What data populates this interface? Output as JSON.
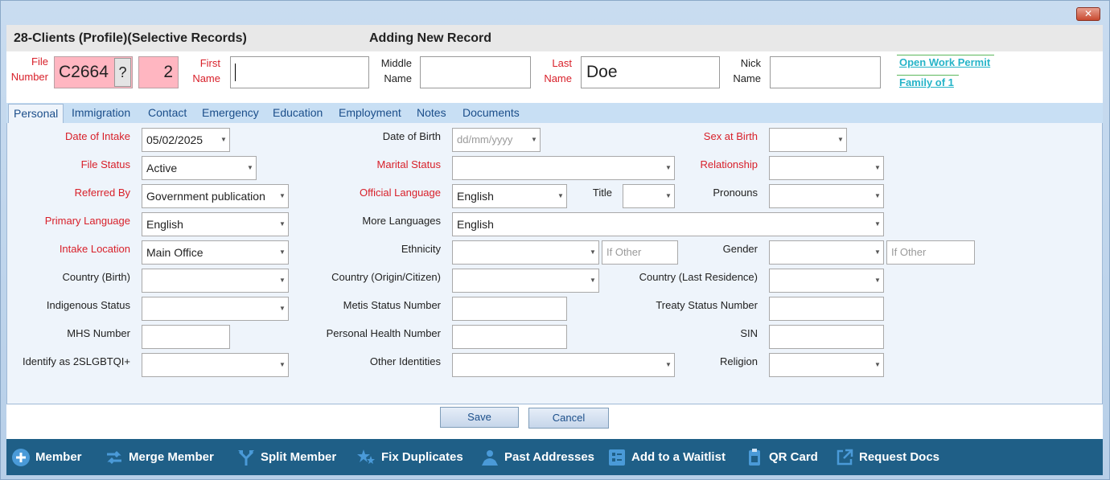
{
  "window": {
    "close_label": "✕"
  },
  "header": {
    "title": "28-Clients (Profile)(Selective Records)",
    "mode": "Adding New Record",
    "file_number_label_1": "File",
    "file_number_label_2": "Number",
    "file_number": "C2664",
    "lookup_label": "?",
    "sequence": "2",
    "first_name_label_1": "First",
    "first_name_label_2": "Name",
    "first_name_value": "",
    "middle_name_label_1": "Middle",
    "middle_name_label_2": "Name",
    "middle_name_value": "",
    "last_name_label_1": "Last",
    "last_name_label_2": "Name",
    "last_name_value": "Doe",
    "nick_name_label_1": "Nick",
    "nick_name_label_2": "Name",
    "nick_name_value": "",
    "link_open_work_permit": "Open Work Permit",
    "link_family": "Family of 1"
  },
  "tabs": [
    "Personal",
    "Immigration",
    "Contact",
    "Emergency",
    "Education",
    "Employment",
    "Notes",
    "Documents"
  ],
  "form": {
    "date_of_intake": {
      "label": "Date of Intake",
      "value": "05/02/2025"
    },
    "date_of_birth": {
      "label": "Date of Birth",
      "placeholder": "dd/mm/yyyy"
    },
    "sex_at_birth": {
      "label": "Sex at Birth",
      "value": ""
    },
    "file_status": {
      "label": "File Status",
      "value": "Active"
    },
    "marital_status": {
      "label": "Marital Status",
      "value": ""
    },
    "relationship": {
      "label": "Relationship",
      "value": ""
    },
    "referred_by": {
      "label": "Referred By",
      "value": "Government publication"
    },
    "official_language": {
      "label": "Official Language",
      "value": "English"
    },
    "title": {
      "label": "Title",
      "value": ""
    },
    "pronouns": {
      "label": "Pronouns",
      "value": ""
    },
    "primary_language": {
      "label": "Primary Language",
      "value": "English"
    },
    "more_languages": {
      "label": "More Languages",
      "value": "English"
    },
    "intake_location": {
      "label": "Intake Location",
      "value": "Main Office"
    },
    "ethnicity": {
      "label": "Ethnicity",
      "value": "",
      "other_placeholder": "If Other"
    },
    "gender": {
      "label": "Gender",
      "value": "",
      "other_placeholder": "If Other"
    },
    "country_birth": {
      "label": "Country (Birth)",
      "value": ""
    },
    "country_origin": {
      "label": "Country (Origin/Citizen)",
      "value": ""
    },
    "country_last": {
      "label": "Country (Last Residence)",
      "value": ""
    },
    "indigenous_status": {
      "label": "Indigenous Status",
      "value": ""
    },
    "metis_status_number": {
      "label": "Metis Status Number",
      "value": ""
    },
    "treaty_status_number": {
      "label": "Treaty Status Number",
      "value": ""
    },
    "mhs_number": {
      "label": "MHS Number",
      "value": ""
    },
    "personal_health_number": {
      "label": "Personal Health Number",
      "value": ""
    },
    "sin": {
      "label": "SIN",
      "value": ""
    },
    "identify_2slgbtqi": {
      "label": "Identify as 2SLGBTQI+",
      "value": ""
    },
    "other_identities": {
      "label": "Other Identities",
      "value": ""
    },
    "religion": {
      "label": "Religion",
      "value": ""
    }
  },
  "actions": {
    "save": "Save",
    "cancel": "Cancel"
  },
  "toolbar": [
    {
      "label": "Member",
      "icon": "plus-circle-icon"
    },
    {
      "label": "Merge Member",
      "icon": "merge-arrows-icon"
    },
    {
      "label": "Split Member",
      "icon": "split-arrows-icon"
    },
    {
      "label": "Fix Duplicates",
      "icon": "stars-icon"
    },
    {
      "label": "Past Addresses",
      "icon": "map-pin-person-icon"
    },
    {
      "label": "Add to a Waitlist",
      "icon": "waitlist-icon"
    },
    {
      "label": "QR Card",
      "icon": "badge-icon"
    },
    {
      "label": "Request Docs",
      "icon": "external-link-icon"
    }
  ],
  "colors": {
    "required_label": "#d8202a",
    "toolbar_bg": "#1f5f87",
    "pink_field": "#ffb6c1",
    "link": "#26b4c8"
  }
}
